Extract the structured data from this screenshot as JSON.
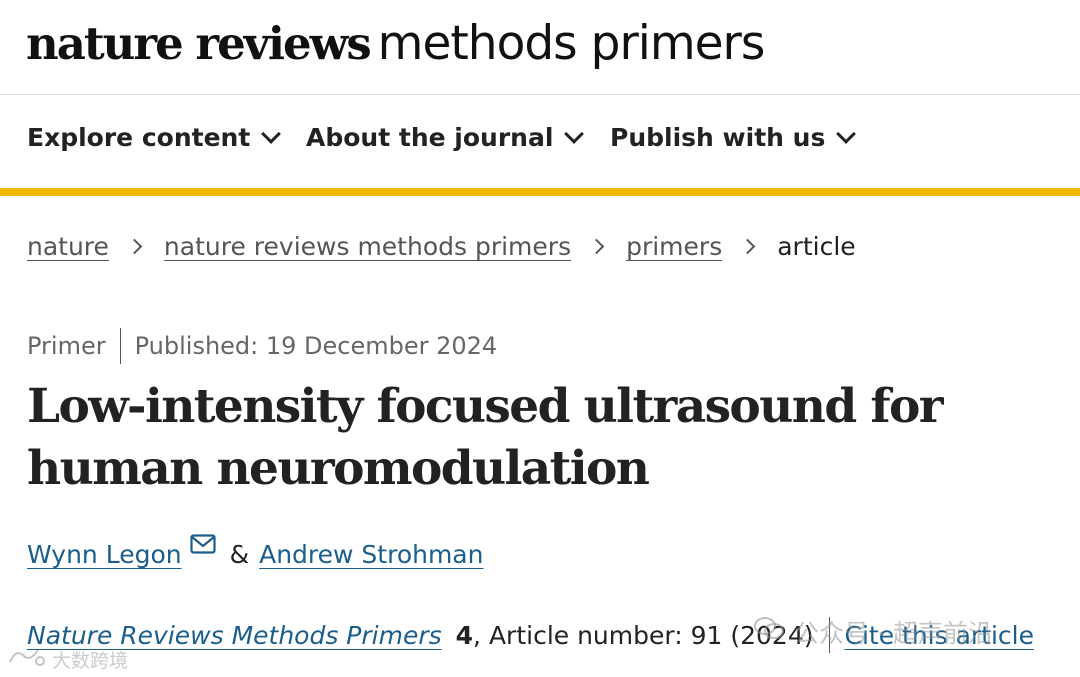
{
  "header": {
    "logo_bold": "nature reviews",
    "logo_light": "methods primers"
  },
  "nav": {
    "items": [
      {
        "label": "Explore content",
        "icon": "chevron-down-icon"
      },
      {
        "label": "About the journal",
        "icon": "chevron-down-icon"
      },
      {
        "label": "Publish with us",
        "icon": "chevron-down-icon"
      }
    ],
    "accent_color": "#f2b700"
  },
  "breadcrumb": {
    "items": [
      "nature",
      "nature reviews methods primers",
      "primers"
    ],
    "current": "article",
    "separator_icon": "chevron-right-icon"
  },
  "article": {
    "type": "Primer",
    "published": "Published: 19 December 2024",
    "title": "Low-intensity focused ultrasound for human neuromodulation",
    "authors": [
      {
        "name": "Wynn Legon",
        "icon": "mail-icon"
      },
      {
        "name": "Andrew Strohman"
      }
    ],
    "author_separator": "&",
    "citation": {
      "journal": "Nature Reviews Methods Primers",
      "volume": "4",
      "article_number": ", Article number: 91 (2024)",
      "cite_label": "Cite this article"
    },
    "link_color": "#1b5e8c"
  },
  "watermarks": {
    "right": "公众号 · 超声前沿",
    "left": "大数跨境"
  }
}
